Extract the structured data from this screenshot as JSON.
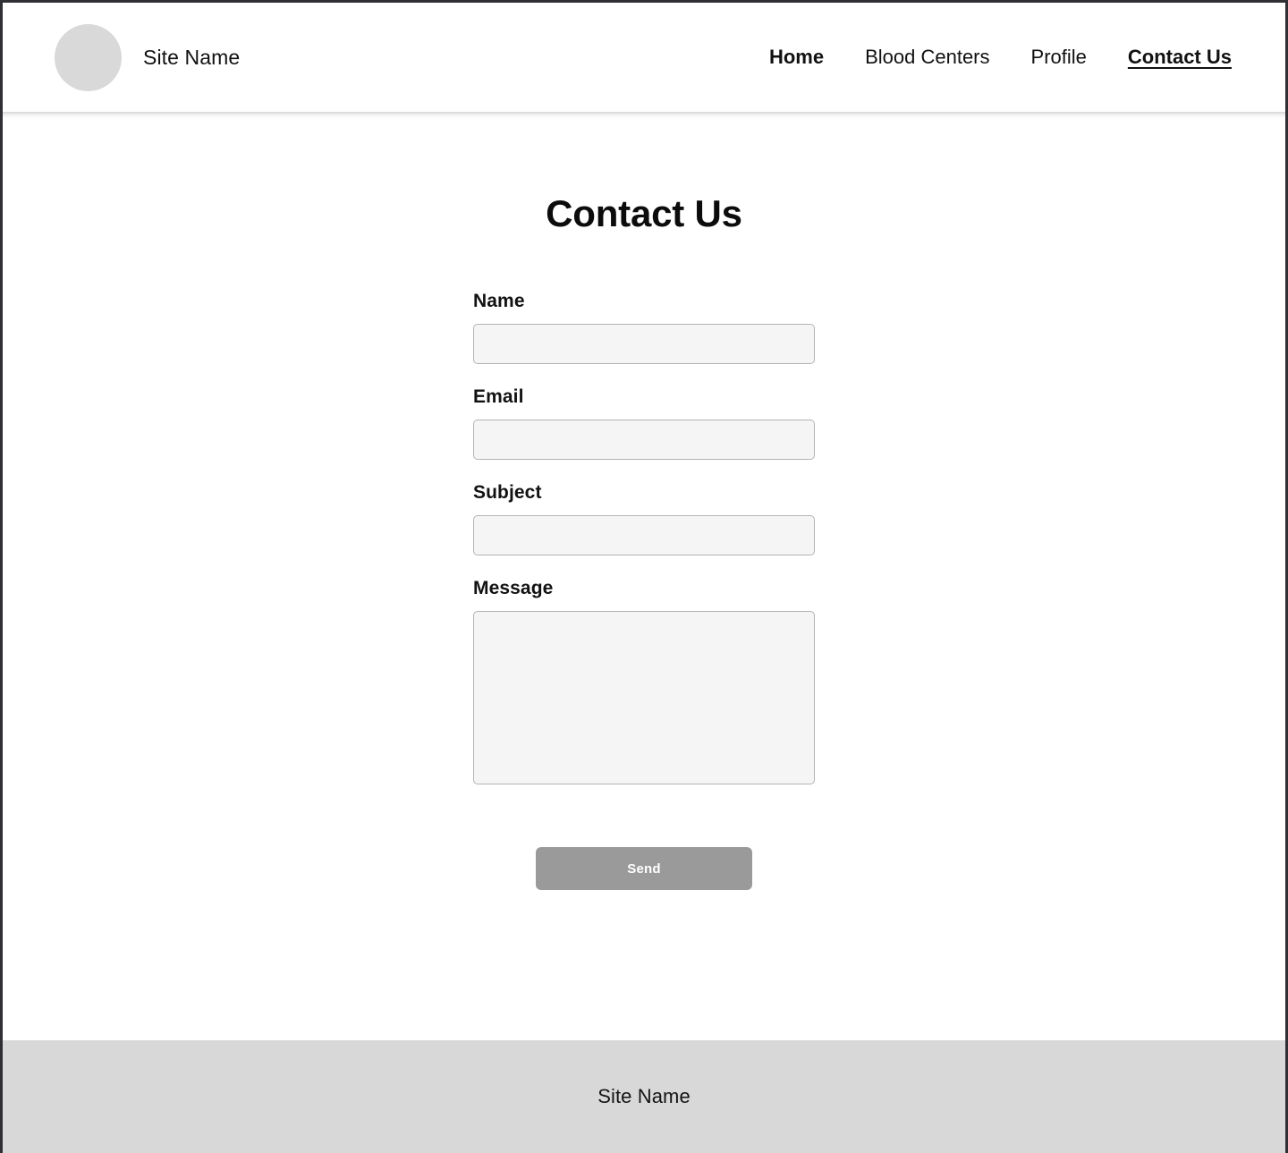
{
  "header": {
    "brand_name": "Site Name",
    "avatar_icon": "avatar-placeholder-circle",
    "nav": [
      {
        "label": "Home",
        "weight": "bold",
        "active": false
      },
      {
        "label": "Blood Centers",
        "weight": "normal",
        "active": false
      },
      {
        "label": "Profile",
        "weight": "normal",
        "active": false
      },
      {
        "label": "Contact Us",
        "weight": "bold",
        "active": true
      }
    ]
  },
  "main": {
    "page_title": "Contact Us",
    "form": {
      "fields": [
        {
          "label": "Name",
          "value": "",
          "placeholder": "",
          "type": "text"
        },
        {
          "label": "Email",
          "value": "",
          "placeholder": "",
          "type": "text"
        },
        {
          "label": "Subject",
          "value": "",
          "placeholder": "",
          "type": "text"
        },
        {
          "label": "Message",
          "value": "",
          "placeholder": "",
          "type": "textarea"
        }
      ],
      "submit_label": "Send"
    }
  },
  "footer": {
    "site_name": "Site Name"
  },
  "colors": {
    "page_border": "#2e3033",
    "header_bg": "#ffffff",
    "avatar_fill": "#d9d9d9",
    "input_bg": "#f5f5f5",
    "input_border": "#b3b3b3",
    "button_bg": "#9a9a9a",
    "button_text": "#ffffff",
    "footer_bg": "#d8d8d8",
    "text": "#111111"
  }
}
